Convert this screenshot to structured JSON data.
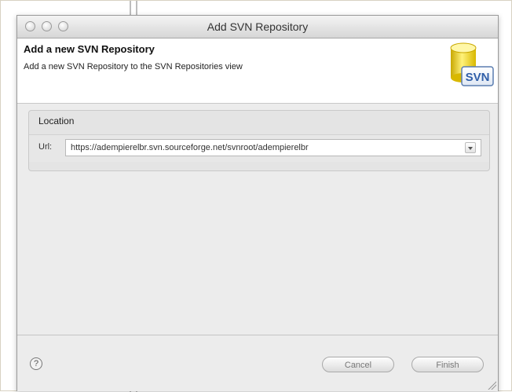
{
  "window": {
    "title": "Add SVN Repository"
  },
  "header": {
    "title": "Add a new SVN Repository",
    "description": "Add a new SVN Repository to the SVN Repositories view",
    "logo_text": "SVN",
    "logo_icon": "svn-database-icon"
  },
  "location": {
    "group_label": "Location",
    "url_label": "Url:",
    "url_value": "https://adempierelbr.svn.sourceforge.net/svnroot/adempierelbr"
  },
  "footer": {
    "help_glyph": "?",
    "cancel_label": "Cancel",
    "finish_label": "Finish"
  }
}
